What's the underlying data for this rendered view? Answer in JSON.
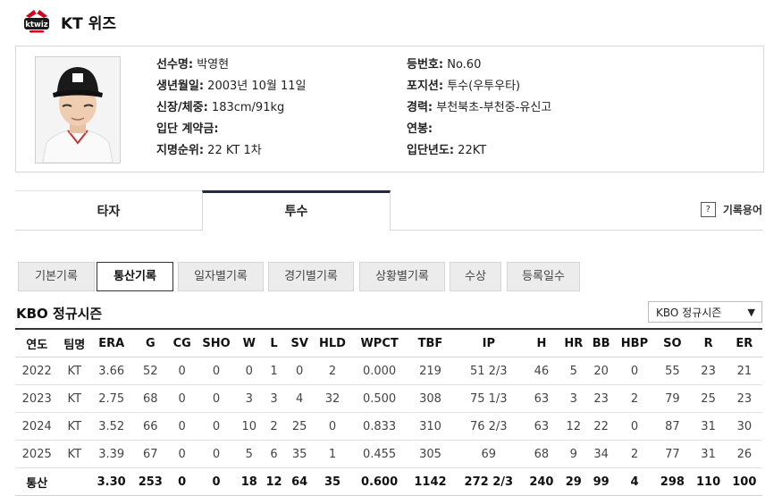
{
  "header": {
    "team_name": "KT 위즈",
    "logo_text": "ktwiz"
  },
  "player": {
    "fields_left": [
      {
        "label": "선수명:",
        "value": " 박영현"
      },
      {
        "label": "생년월일:",
        "value": " 2003년 10월 11일"
      },
      {
        "label": "신장/체중:",
        "value": " 183cm/91kg"
      },
      {
        "label": "입단 계약금:",
        "value": ""
      },
      {
        "label": "지명순위:",
        "value": " 22 KT 1차"
      }
    ],
    "fields_right": [
      {
        "label": "등번호:",
        "value": " No.60"
      },
      {
        "label": "포지션:",
        "value": " 투수(우투우타)"
      },
      {
        "label": "경력:",
        "value": " 부천북초-부천중-유신고"
      },
      {
        "label": "연봉:",
        "value": ""
      },
      {
        "label": "입단년도:",
        "value": " 22KT"
      }
    ]
  },
  "tabs": {
    "hitter": "타자",
    "pitcher": "투수",
    "glossary": "기록용어",
    "glossary_icon": "?"
  },
  "subtabs": [
    "기본기록",
    "통산기록",
    "일자별기록",
    "경기별기록",
    "상황별기록",
    "수상",
    "등록일수"
  ],
  "section_title": "KBO 정규시즌",
  "season_select": {
    "selected": "KBO 정규시즌"
  },
  "table": {
    "headers": [
      "연도",
      "팀명",
      "ERA",
      "G",
      "CG",
      "SHO",
      "W",
      "L",
      "SV",
      "HLD",
      "WPCT",
      "TBF",
      "IP",
      "H",
      "HR",
      "BB",
      "HBP",
      "SO",
      "R",
      "ER"
    ],
    "rows": [
      [
        "2022",
        "KT",
        "3.66",
        "52",
        "0",
        "0",
        "0",
        "1",
        "0",
        "2",
        "0.000",
        "219",
        "51 2/3",
        "46",
        "5",
        "20",
        "0",
        "55",
        "23",
        "21"
      ],
      [
        "2023",
        "KT",
        "2.75",
        "68",
        "0",
        "0",
        "3",
        "3",
        "4",
        "32",
        "0.500",
        "308",
        "75 1/3",
        "63",
        "3",
        "23",
        "2",
        "79",
        "25",
        "23"
      ],
      [
        "2024",
        "KT",
        "3.52",
        "66",
        "0",
        "0",
        "10",
        "2",
        "25",
        "0",
        "0.833",
        "310",
        "76 2/3",
        "63",
        "12",
        "22",
        "0",
        "87",
        "31",
        "30"
      ],
      [
        "2025",
        "KT",
        "3.39",
        "67",
        "0",
        "0",
        "5",
        "6",
        "35",
        "1",
        "0.455",
        "305",
        "69",
        "68",
        "9",
        "34",
        "2",
        "77",
        "31",
        "26"
      ]
    ],
    "total": [
      "통산",
      "",
      "3.30",
      "253",
      "0",
      "0",
      "18",
      "12",
      "64",
      "35",
      "0.600",
      "1142",
      "272 2/3",
      "240",
      "29",
      "99",
      "4",
      "298",
      "110",
      "100"
    ]
  },
  "colors": {
    "active_tab_border": "#1f2a44",
    "kt_red": "#d6001c"
  }
}
